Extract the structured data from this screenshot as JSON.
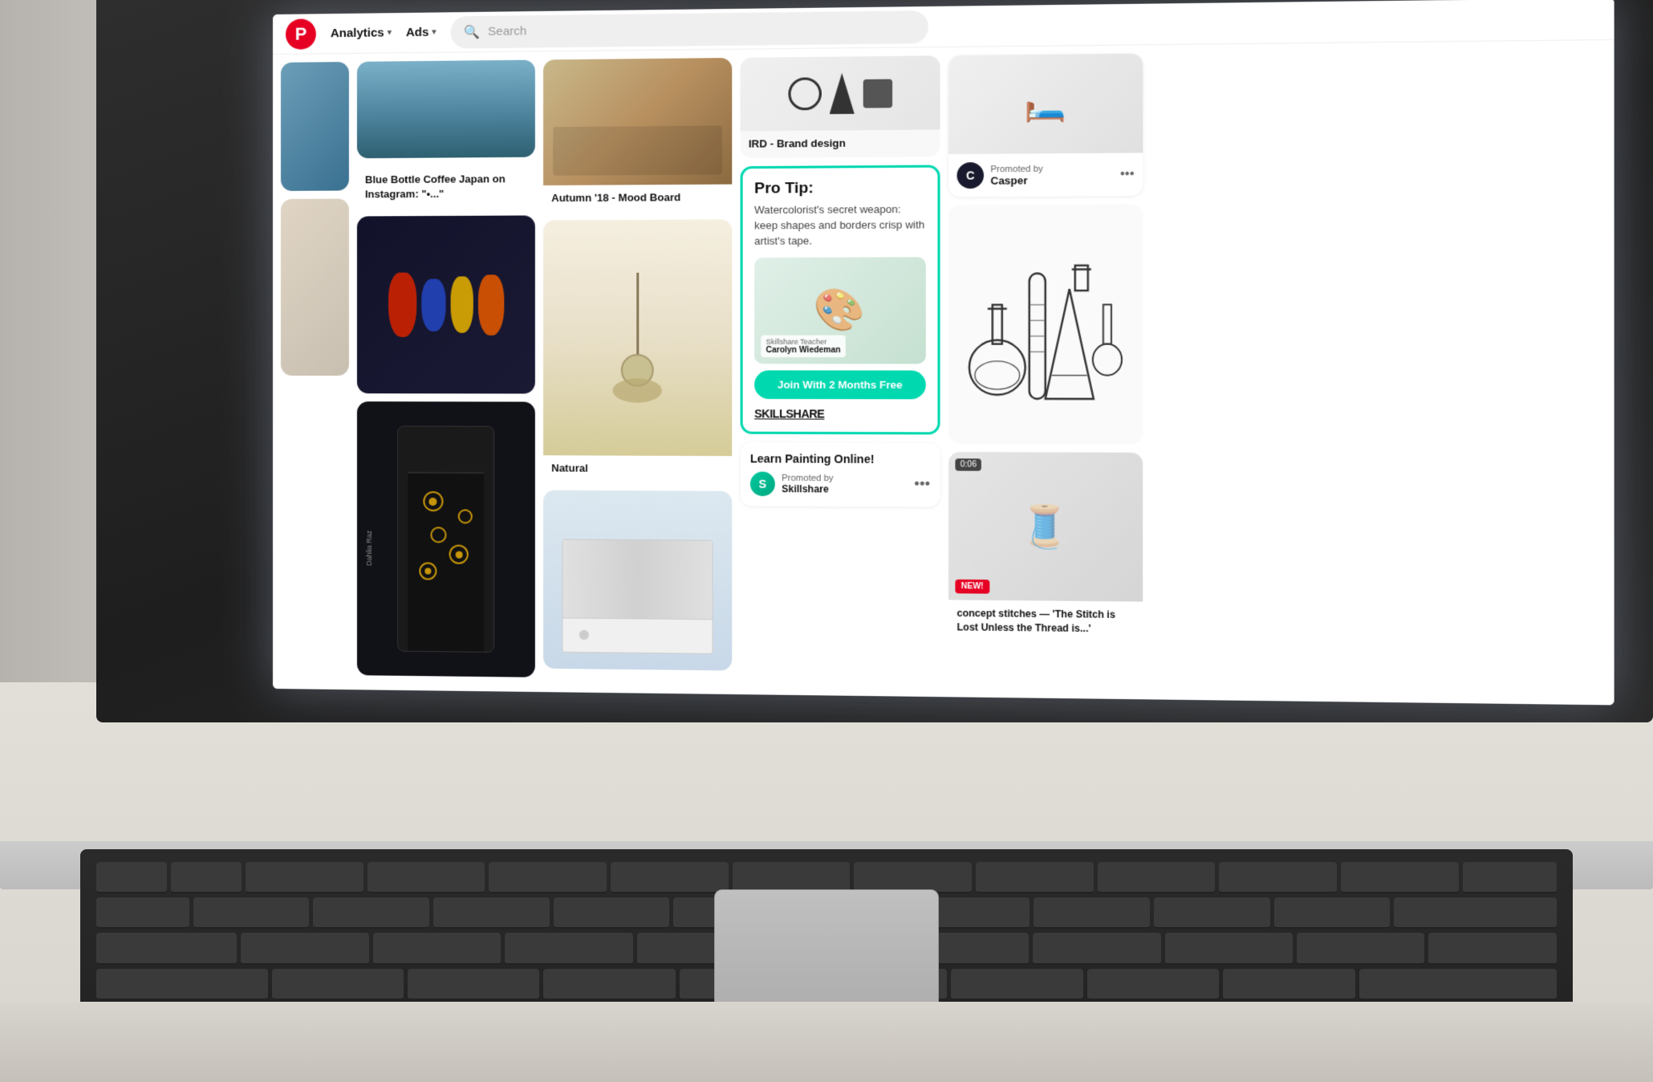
{
  "app": {
    "name": "Pinterest",
    "logo_char": "P"
  },
  "nav": {
    "analytics_label": "Analytics",
    "ads_label": "Ads",
    "search_placeholder": "Search"
  },
  "pins": {
    "autumn_mood": {
      "title": "Autumn '18 - Mood Board"
    },
    "blue_bottle": {
      "title": "Blue Bottle Coffee Japan on Instagram: \"•...\""
    },
    "ird": {
      "title": "IRD - Brand design"
    },
    "natural": {
      "title": "Natural"
    },
    "pro_tip": {
      "label": "Pro Tip:",
      "description": "Watercolorist's secret weapon: keep shapes and borders crisp with artist's tape.",
      "teacher_label": "Skillshare Teacher",
      "teacher_name": "Carolyn Wiedeman",
      "cta_button": "Join With 2 Months Free",
      "brand": "SKILLSHARE"
    },
    "skillshare_promoted": {
      "title": "Learn Painting Online!",
      "promoted_label": "Promoted by",
      "brand": "Skillshare"
    },
    "casper": {
      "promoted_label": "Promoted by",
      "name": "Casper"
    },
    "concept_stitches": {
      "title": "concept stitches — 'The Stitch is Lost Unless the Thread is...'",
      "time_badge": "0:06",
      "new_badge": "NEW!"
    },
    "dahlia_raz": {
      "watermark": "Dahlia Raz"
    }
  },
  "colors": {
    "pinterest_red": "#e60023",
    "teal_border": "#00d8b0",
    "teal_button": "#00d8b0",
    "dark_bg": "#1a1a1a",
    "light_bg": "#f0f0f0"
  }
}
